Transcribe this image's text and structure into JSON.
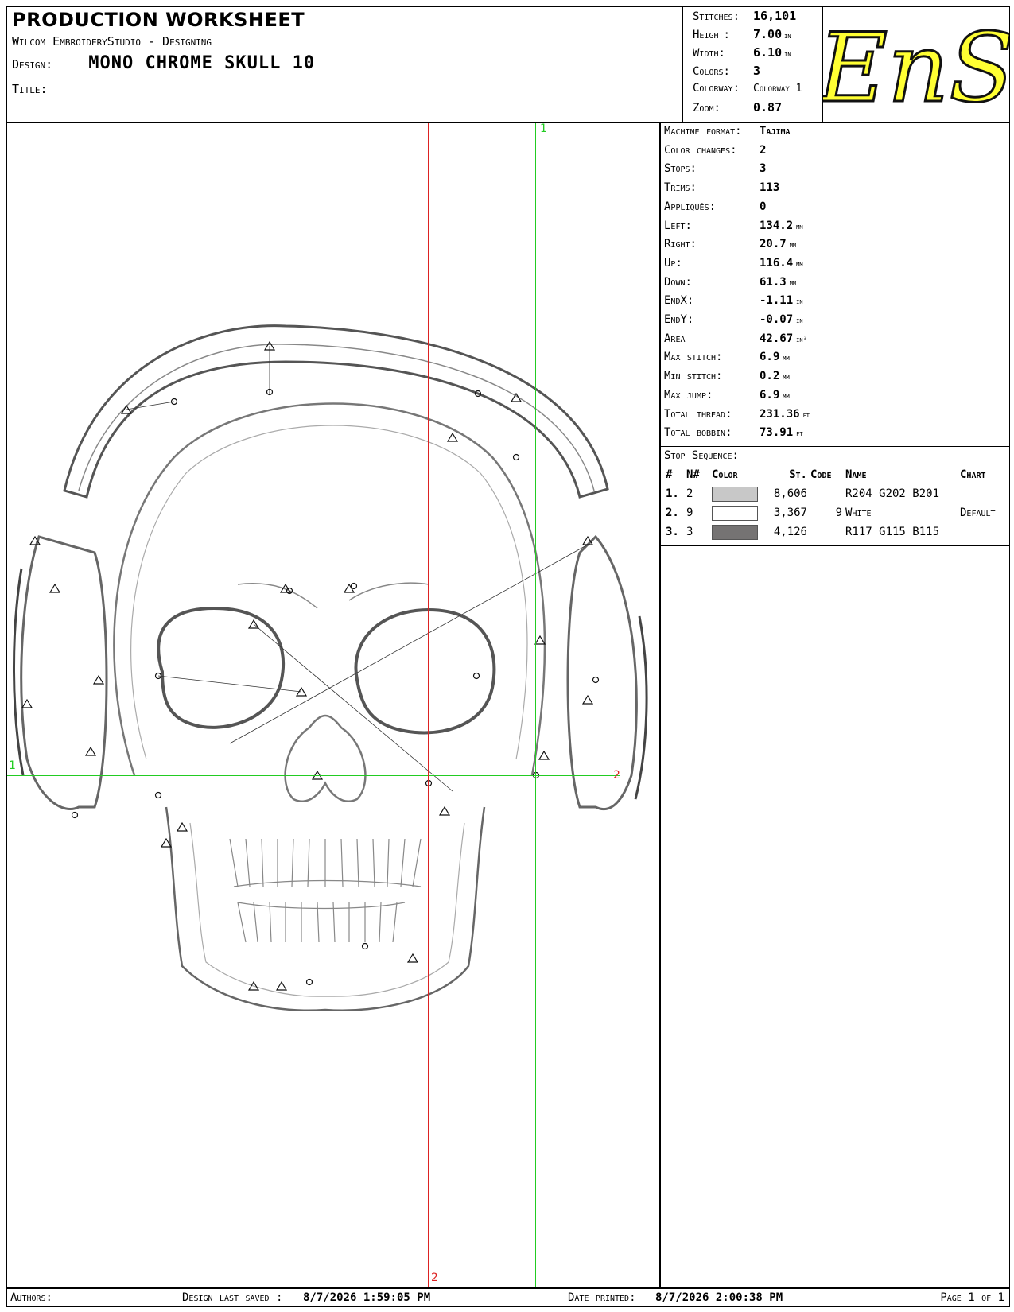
{
  "header": {
    "title": "PRODUCTION WORKSHEET",
    "software": "Wilcom EmbroideryStudio - Designing",
    "design_label": "Design:",
    "design_name": "MONO CHROME SKULL  10",
    "title_label": "Title:"
  },
  "stats": {
    "stitches_label": "Stitches:",
    "stitches": "16,101",
    "height_label": "Height:",
    "height": "7.00",
    "height_unit": "in",
    "width_label": "Width:",
    "width": "6.10",
    "width_unit": "in",
    "colors_label": "Colors:",
    "colors": "3",
    "colorway_label": "Colorway:",
    "colorway": "Colorway 1",
    "zoom_label": "Zoom:",
    "zoom": "0.87"
  },
  "logo": {
    "text": "EnS",
    "fill": "#ffff33",
    "stroke": "#111111"
  },
  "info": {
    "rows": [
      {
        "k": "Machine format:",
        "v": "Tajima",
        "u": ""
      },
      {
        "k": "Color changes:",
        "v": "2",
        "u": ""
      },
      {
        "k": "Stops:",
        "v": "3",
        "u": ""
      },
      {
        "k": "Trims:",
        "v": "113",
        "u": ""
      },
      {
        "k": "Appliqués:",
        "v": "0",
        "u": ""
      },
      {
        "k": "Left:",
        "v": "134.2",
        "u": "mm"
      },
      {
        "k": "Right:",
        "v": "20.7",
        "u": "mm"
      },
      {
        "k": "Up:",
        "v": "116.4",
        "u": "mm"
      },
      {
        "k": "Down:",
        "v": "61.3",
        "u": "mm"
      },
      {
        "k": "EndX:",
        "v": "-1.11",
        "u": "in"
      },
      {
        "k": "EndY:",
        "v": "-0.07",
        "u": "in"
      },
      {
        "k": "Area",
        "v": "42.67",
        "u": "in²"
      },
      {
        "k": "Max stitch:",
        "v": "6.9",
        "u": "mm"
      },
      {
        "k": "Min stitch:",
        "v": "0.2",
        "u": "mm"
      },
      {
        "k": "Max jump:",
        "v": "6.9",
        "u": "mm"
      },
      {
        "k": "Total thread:",
        "v": "231.36",
        "u": "ft"
      },
      {
        "k": "Total bobbin:",
        "v": "73.91",
        "u": "ft"
      }
    ]
  },
  "stop_sequence": {
    "title": "Stop Sequence:",
    "headers": [
      "#",
      "N#",
      "Color",
      "St.",
      "Code",
      "Name",
      "Chart"
    ],
    "rows": [
      {
        "num": "1.",
        "n": "2",
        "color": "#c8c8c8",
        "st": "8,606",
        "code": "",
        "name": "R204 G202 B201",
        "chart": ""
      },
      {
        "num": "2.",
        "n": "9",
        "color": "#ffffff",
        "st": "3,367",
        "code": "9",
        "name": "White",
        "chart": "Default"
      },
      {
        "num": "3.",
        "n": "3",
        "color": "#757373",
        "st": "4,126",
        "code": "",
        "name": "R117 G115 B115",
        "chart": ""
      }
    ]
  },
  "axes": {
    "green_label_top": "1",
    "green_label_left": "1",
    "red_label_right": "2",
    "red_label_bottom": "2",
    "green": "#22cc22",
    "red": "#dd2222"
  },
  "footer": {
    "authors_label": "Authors:",
    "saved_label": "Design last saved :",
    "saved": "8/7/2026 1:59:05 PM",
    "printed_label": "Date printed:",
    "printed": "8/7/2026 2:00:38 PM",
    "page": "Page 1 of 1"
  }
}
